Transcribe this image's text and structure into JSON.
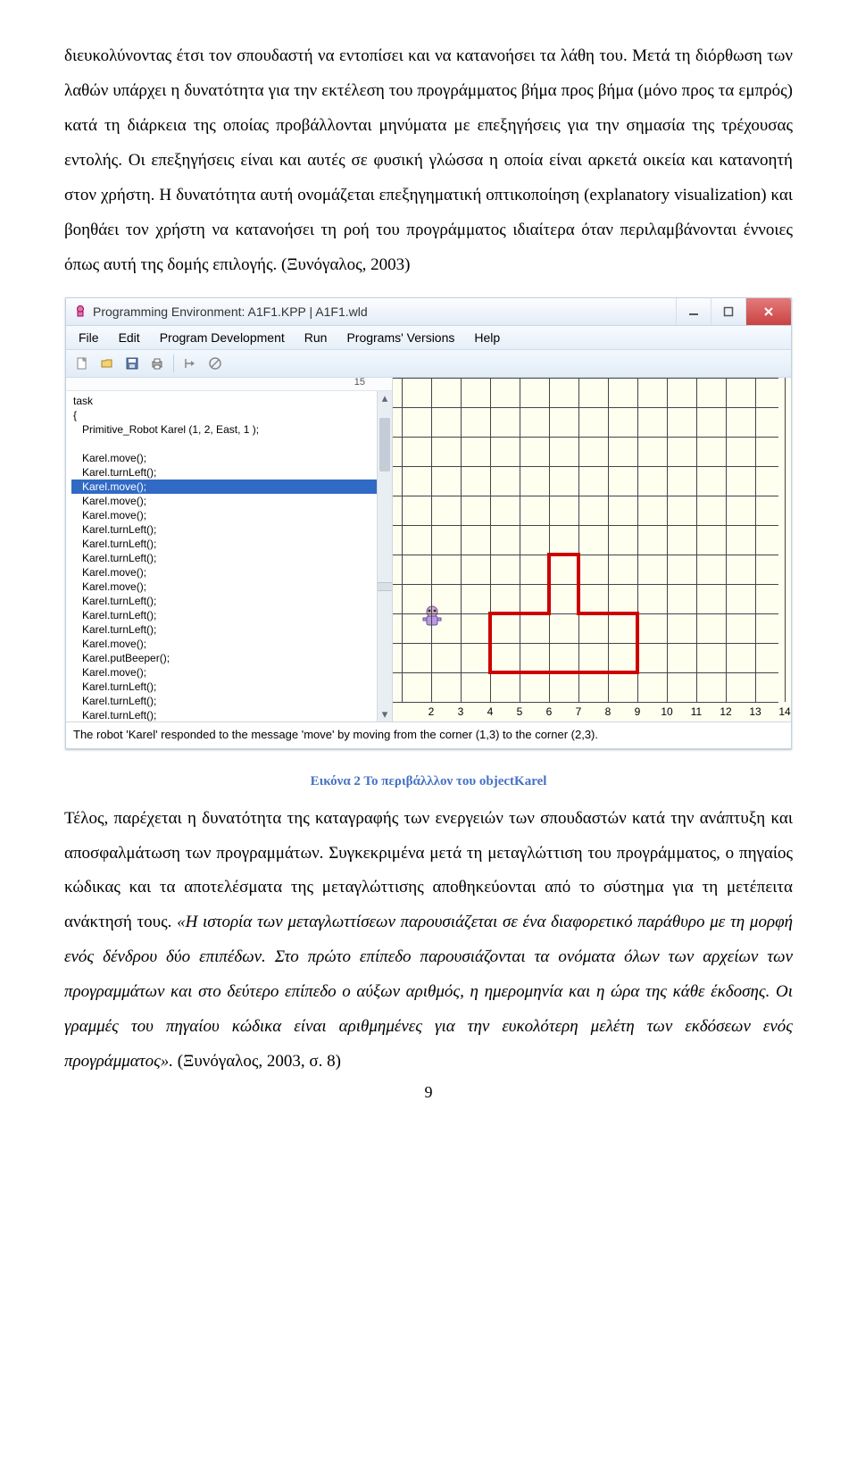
{
  "prose": {
    "para1": "διευκολύνοντας έτσι τον σπουδαστή να εντοπίσει και να κατανοήσει τα λάθη του. Μετά τη διόρθωση των λαθών υπάρχει η δυνατότητα για την εκτέλεση του προγράμματος βήμα προς βήμα (μόνο προς τα εμπρός) κατά τη διάρκεια της οποίας προβάλλονται μηνύματα με επεξηγήσεις για την σημασία της τρέχουσας εντολής. Οι επεξηγήσεις είναι και αυτές σε φυσική γλώσσα η οποία είναι αρκετά οικεία και κατανοητή στον χρήστη. Η δυνατότητα αυτή ονομάζεται επεξηγηματική οπτικοποίηση (explanatory visualization) και βοηθάει τον χρήστη να κατανοήσει τη ροή του προγράμματος ιδιαίτερα όταν περιλαμβάνονται έννοιες όπως αυτή της δομής επιλογής. (Ξυνόγαλος, 2003)",
    "figure_caption": "Εικόνα 2 Το περιβάλλλον του objectKarel",
    "para2": "Τέλος, παρέχεται η δυνατότητα της καταγραφής των ενεργειών των σπουδαστών κατά την ανάπτυξη και αποσφαλμάτωση των προγραμμάτων. Συγκεκριμένα μετά τη μεταγλώττιση του προγράμματος, ο πηγαίος κώδικας και τα αποτελέσματα της μεταγλώττισης αποθηκεύονται από το σύστημα για τη μετέπειτα ανάκτησή τους. ",
    "para2_italic": "«Η ιστορία των μεταγλωττίσεων παρουσιάζεται σε ένα διαφορετικό παράθυρο με τη μορφή ενός δένδρου δύο επιπέδων. Στο πρώτο επίπεδο παρουσιάζονται τα ονόματα όλων των αρχείων των προγραμμάτων και στο δεύτερο επίπεδο ο αύξων αριθμός, η ημερομηνία και η ώρα της κάθε έκδοσης. Οι γραμμές του πηγαίου κώδικα είναι αριθμημένες για την ευκολότερη μελέτη των εκδόσεων ενός προγράμματος».",
    "para2_tail": " (Ξυνόγαλος, 2003, σ. 8)",
    "page_number": "9"
  },
  "app": {
    "title": "Programming Environment: A1F1.KPP | A1F1.wld",
    "menus": [
      "File",
      "Edit",
      "Program Development",
      "Run",
      "Programs' Versions",
      "Help"
    ],
    "ruler_mark": "15",
    "code": {
      "lines": [
        "task",
        "{",
        "   Primitive_Robot Karel (1, 2, East, 1 );",
        "",
        "   Karel.move();",
        "   Karel.turnLeft();",
        "   Karel.move();",
        "   Karel.move();",
        "   Karel.move();",
        "   Karel.turnLeft();",
        "   Karel.turnLeft();",
        "   Karel.turnLeft();",
        "   Karel.move();",
        "   Karel.move();",
        "   Karel.turnLeft();",
        "   Karel.turnLeft();",
        "   Karel.turnLeft();",
        "   Karel.move();",
        "   Karel.putBeeper();",
        "   Karel.move();",
        "   Karel.turnLeft();",
        "   Karel.turnLeft();",
        "   Karel.turnLeft();"
      ],
      "selected_index": 6,
      "selected_text": "   Karel.move();"
    },
    "axis_labels": [
      "2",
      "3",
      "4",
      "5",
      "6",
      "7",
      "8",
      "9",
      "10",
      "11",
      "12",
      "13",
      "14"
    ],
    "status_text": "The robot 'Karel' responded to the message 'move' by moving from the corner (1,3) to the corner (2,3)."
  }
}
